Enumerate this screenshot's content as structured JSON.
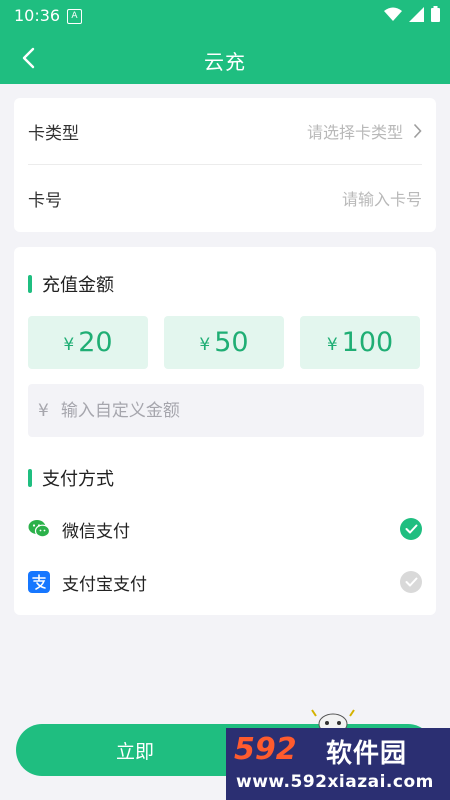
{
  "status_bar": {
    "time": "10:36",
    "notif_icon": "A"
  },
  "app_bar": {
    "title": "云充",
    "back_icon": "chevron-left-icon"
  },
  "card_form": {
    "card_type": {
      "label": "卡类型",
      "placeholder": "请选择卡类型"
    },
    "card_number": {
      "label": "卡号",
      "placeholder": "请输入卡号"
    }
  },
  "recharge": {
    "section_title": "充值金额",
    "currency": "¥",
    "amounts": [
      {
        "value": "20"
      },
      {
        "value": "50"
      },
      {
        "value": "100"
      }
    ],
    "custom_placeholder": "输入自定义金额"
  },
  "payment": {
    "section_title": "支付方式",
    "methods": [
      {
        "label": "微信支付",
        "selected": true
      },
      {
        "label": "支付宝支付",
        "selected": false
      }
    ]
  },
  "submit": {
    "label": "立即"
  },
  "watermark": {
    "brand_digits": "592",
    "brand_cn": "软件园",
    "url": "www.592xiazai.com"
  },
  "colors": {
    "accent": "#1fbe80",
    "amount_bg": "#e3f6ee",
    "page_bg": "#f3f3f7"
  }
}
